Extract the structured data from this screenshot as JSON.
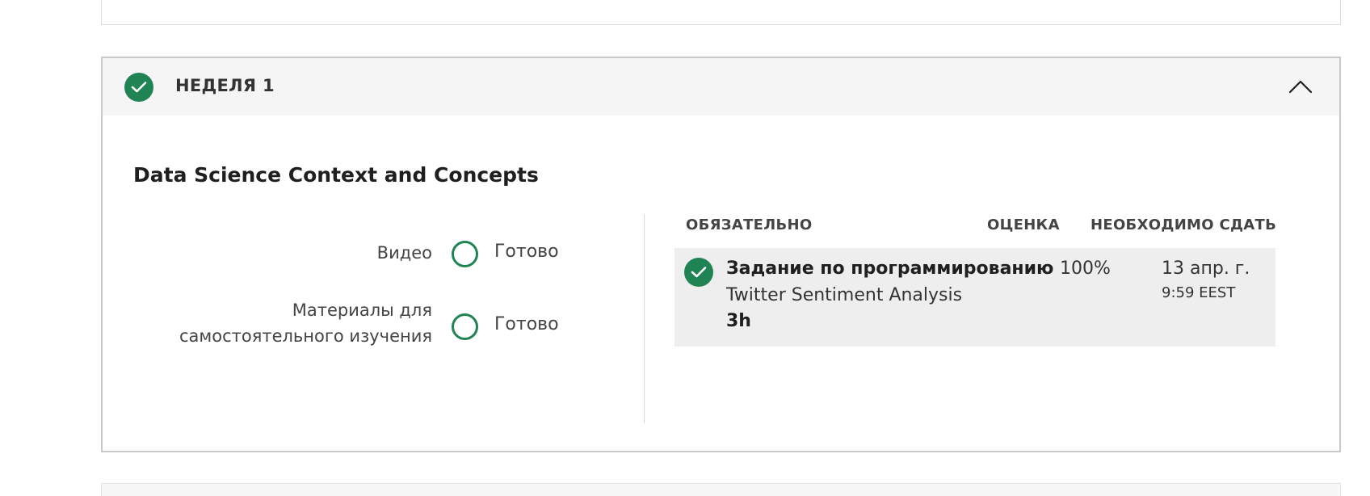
{
  "week": {
    "title": "НЕДЕЛЯ 1",
    "completed": true,
    "expanded": true
  },
  "module": {
    "title": "Data Science Context and Concepts"
  },
  "stats": [
    {
      "label": "Видео",
      "status": "Готово"
    },
    {
      "label_line1": "Материалы для",
      "label_line2": "самостоятельного изучения",
      "status": "Готово"
    }
  ],
  "table": {
    "headers": {
      "required": "ОБЯЗАТЕЛЬНО",
      "grade": "ОЦЕНКА",
      "due": "НЕОБХОДИМО СДАТЬ"
    },
    "rows": [
      {
        "type": "Задание по программированию",
        "name": "Twitter Sentiment Analysis",
        "duration": "3h",
        "grade": "100%",
        "due_date": "13 апр. г.",
        "due_time": "9:59 EEST",
        "completed": true
      }
    ]
  },
  "colors": {
    "accent_green": "#1f8354",
    "header_bg": "#f5f5f5",
    "row_bg": "#eeeeee"
  },
  "icons": {
    "week_status": "check-circle-icon",
    "collapse": "chevron-up-icon",
    "stat_status": "empty-ring-icon",
    "row_status": "check-circle-icon"
  }
}
